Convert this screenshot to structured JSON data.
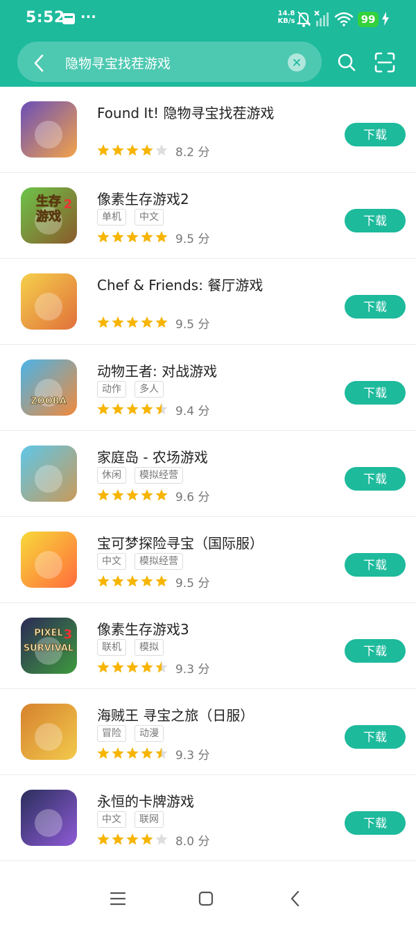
{
  "status_bar": {
    "time": "5:52",
    "dots": "···",
    "net_speed_value": "14.8",
    "net_speed_unit": "KB/s",
    "battery": "99"
  },
  "search": {
    "query": "隐物寻宝找茬游戏",
    "icons": [
      "back-chevron-icon",
      "clear-icon",
      "search-icon",
      "scan-icon"
    ]
  },
  "download_label": "下载",
  "score_unit": "分",
  "apps": [
    {
      "name": "Found It! 隐物寻宝找茬游戏",
      "tags": [],
      "stars": 4,
      "score": "8.2"
    },
    {
      "name": "像素生存游戏2",
      "tags": [
        "单机",
        "中文"
      ],
      "stars": 5,
      "score": "9.5"
    },
    {
      "name": "Chef & Friends: 餐厅游戏",
      "tags": [],
      "stars": 5,
      "score": "9.5"
    },
    {
      "name": "动物王者: 对战游戏",
      "tags": [
        "动作",
        "多人"
      ],
      "stars": 4.5,
      "score": "9.4"
    },
    {
      "name": "家庭岛 - 农场游戏",
      "tags": [
        "休闲",
        "模拟经营"
      ],
      "stars": 5,
      "score": "9.6"
    },
    {
      "name": "宝可梦探险寻宝（国际服）",
      "tags": [
        "中文",
        "模拟经营"
      ],
      "stars": 5,
      "score": "9.5"
    },
    {
      "name": "像素生存游戏3",
      "tags": [
        "联机",
        "模拟"
      ],
      "stars": 4.5,
      "score": "9.3"
    },
    {
      "name": "海贼王 寻宝之旅（日服）",
      "tags": [
        "冒险",
        "动漫"
      ],
      "stars": 4.5,
      "score": "9.3"
    },
    {
      "name": "永恒的卡牌游戏",
      "tags": [
        "中文",
        "联网"
      ],
      "stars": 4,
      "score": "8.0"
    }
  ],
  "icon_art": {
    "0": {
      "lines": []
    },
    "1": {
      "lines": [
        "生存",
        "游戏"
      ],
      "badge": "2"
    },
    "3": {
      "lines": [
        "ZOOBA"
      ]
    },
    "6": {
      "lines": [
        "PIXEL",
        "SURVIVAL"
      ],
      "badge": "3"
    }
  },
  "colors": {
    "accent": "#1dba9c",
    "star": "#f7b500",
    "star_empty": "#dddddd"
  }
}
